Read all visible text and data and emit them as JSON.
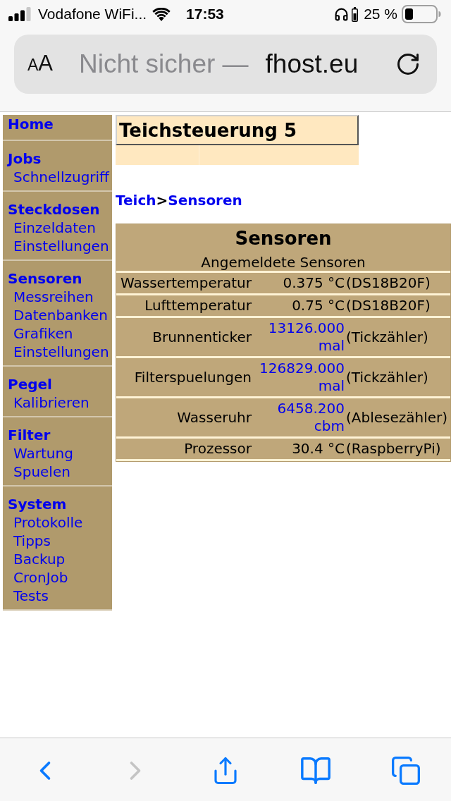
{
  "status_bar": {
    "carrier": "Vodafone WiFi...",
    "time": "17:53",
    "battery": "25 %"
  },
  "address_bar": {
    "text_size_button": "AA",
    "security": "Nicht sicher —",
    "domain": "fhost.eu"
  },
  "sidebar": {
    "sections": [
      {
        "title": "Home"
      },
      {
        "title": "Jobs",
        "items": [
          "Schnellzugriff"
        ]
      },
      {
        "title": "Steckdosen",
        "items": [
          "Einzeldaten",
          "Einstellungen"
        ]
      },
      {
        "title": "Sensoren",
        "items": [
          "Messreihen",
          "Datenbanken",
          "Grafiken",
          "Einstellungen"
        ]
      },
      {
        "title": "Pegel",
        "items": [
          "Kalibrieren"
        ]
      },
      {
        "title": "Filter",
        "items": [
          "Wartung",
          "Spuelen"
        ]
      },
      {
        "title": "System",
        "items": [
          "Protokolle",
          "Tipps",
          "Backup",
          "CronJob",
          "Tests"
        ]
      }
    ]
  },
  "page": {
    "title": "Teichsteuerung 5",
    "breadcrumb": {
      "parent": "Teich",
      "separator": ">",
      "current": "Sensoren"
    }
  },
  "sensor_table": {
    "title": "Sensoren",
    "subtitle": "Angemeldete Sensoren",
    "rows": [
      {
        "name": "Wassertemperatur",
        "value": "0.375 °C",
        "linked": false,
        "type": "(DS18B20F)"
      },
      {
        "name": "Lufttemperatur",
        "value": "0.75 °C",
        "linked": false,
        "type": "(DS18B20F)"
      },
      {
        "name": "Brunnenticker",
        "value": "13126.000 mal",
        "linked": true,
        "type": "(Tickzähler)"
      },
      {
        "name": "Filterspuelungen",
        "value": "126829.000 mal",
        "linked": true,
        "type": "(Tickzähler)"
      },
      {
        "name": "Wasseruhr",
        "value": "6458.200 cbm",
        "linked": true,
        "type": "(Ablesezähler)"
      },
      {
        "name": "Prozessor",
        "value": "30.4 °C",
        "linked": false,
        "type": "(RaspberryPi)"
      }
    ]
  },
  "toolbar": [
    {
      "kind": "back",
      "disabled": false
    },
    {
      "kind": "forward",
      "disabled": true
    },
    {
      "kind": "share",
      "disabled": false
    },
    {
      "kind": "bookmarks",
      "disabled": false
    },
    {
      "kind": "tabs",
      "disabled": false
    }
  ]
}
